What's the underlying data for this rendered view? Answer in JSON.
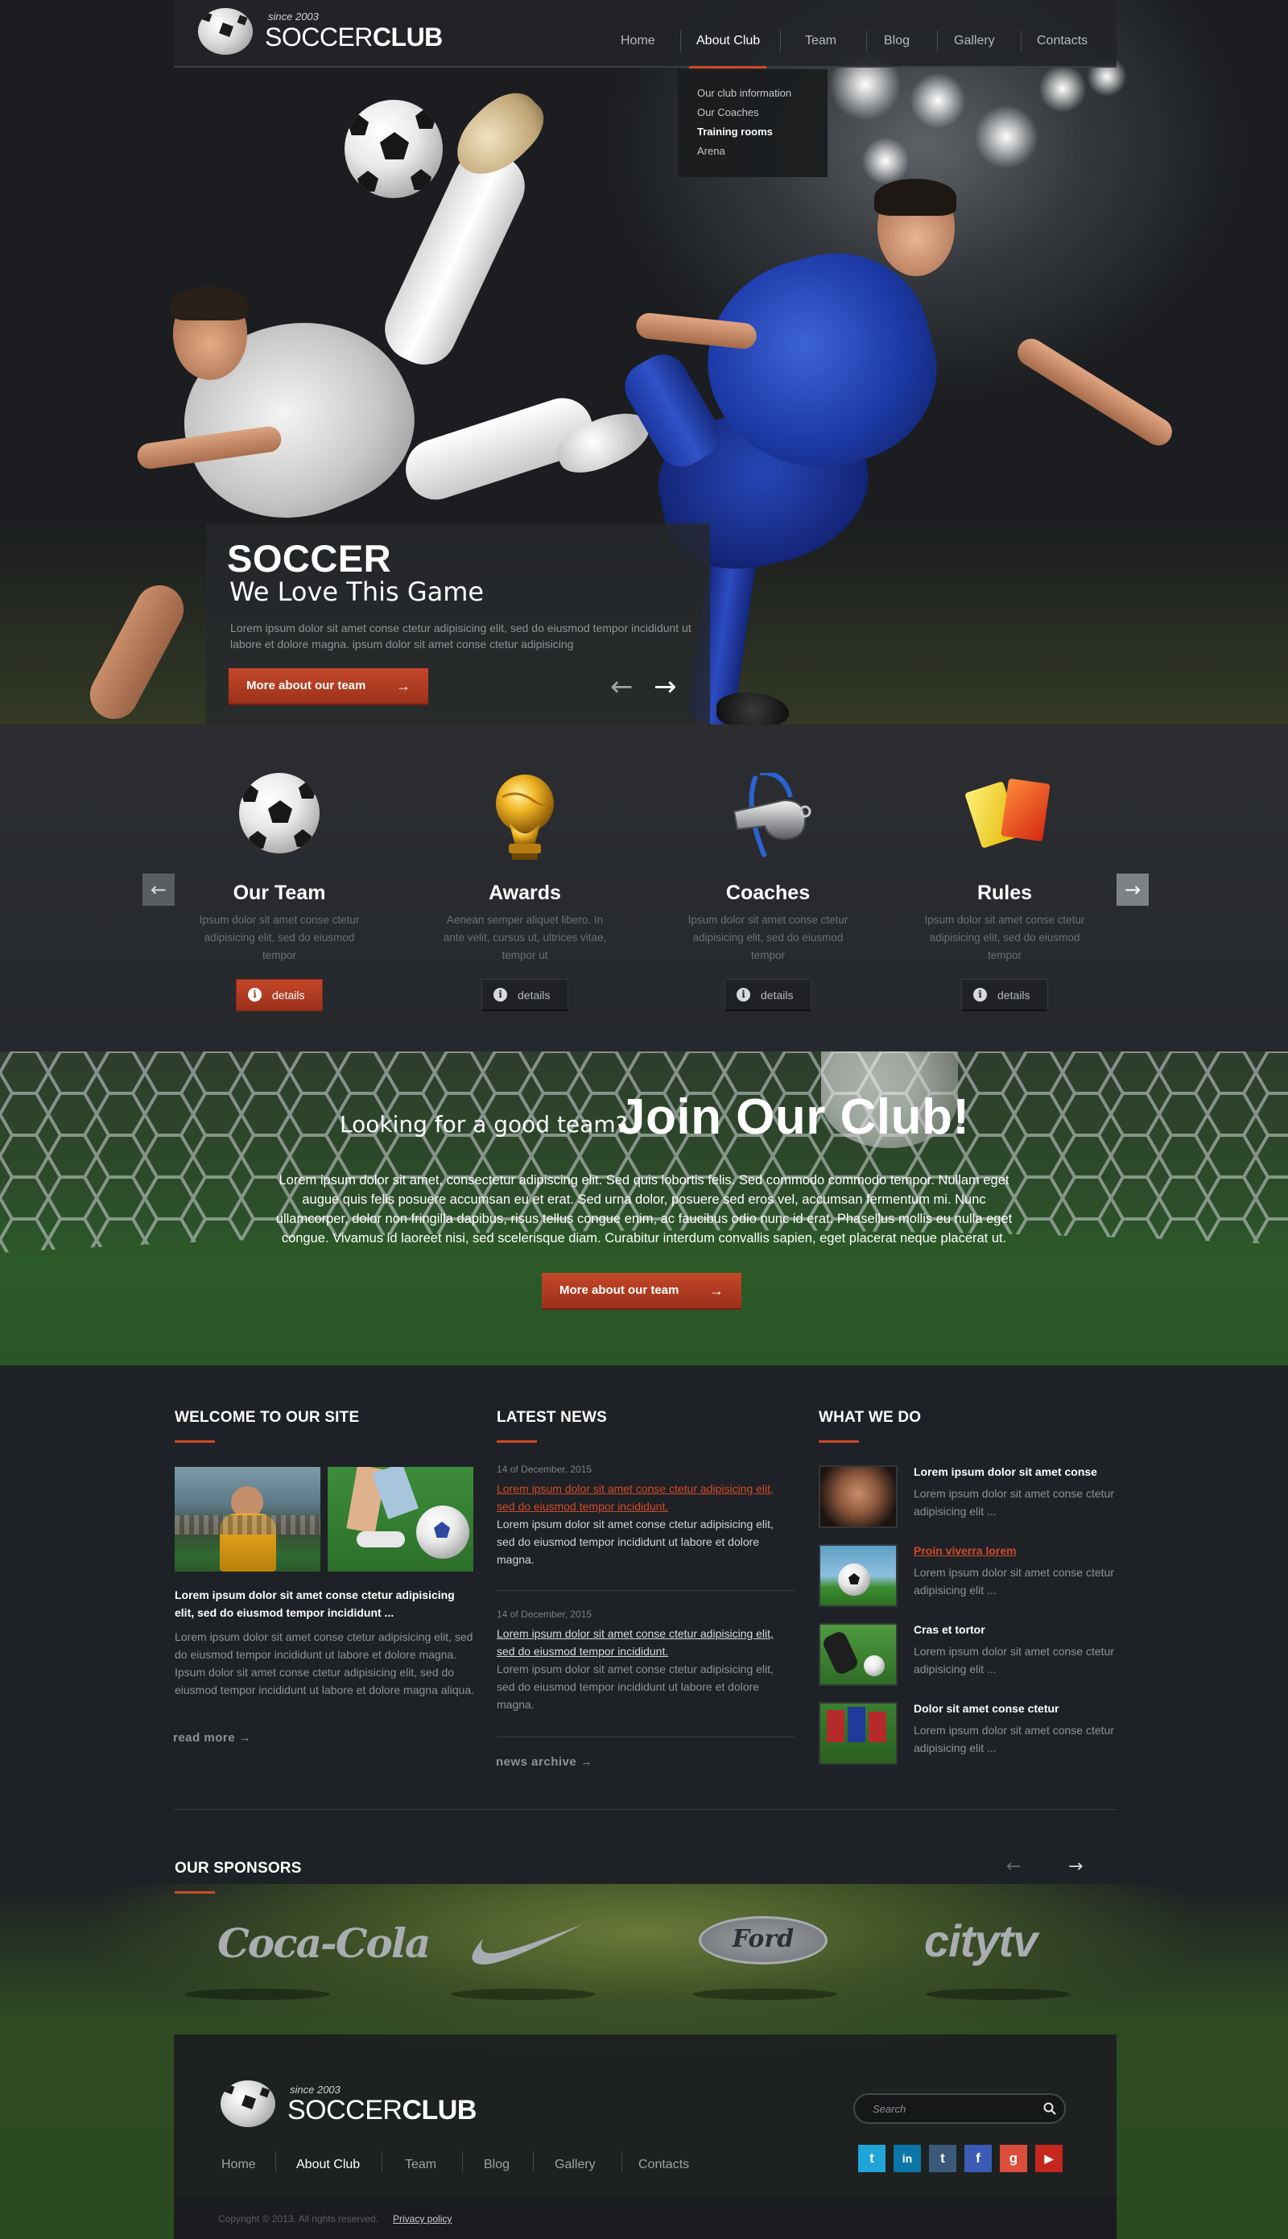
{
  "logo": {
    "tagline": "since 2003",
    "name_light": "SOCCER",
    "name_bold": "CLUB"
  },
  "nav": {
    "items": [
      "Home",
      "About Club",
      "Team",
      "Blog",
      "Gallery",
      "Contacts"
    ],
    "active": "About Club",
    "dropdown": [
      "Our club information",
      "Our Coaches",
      "Training rooms",
      "Arena"
    ],
    "dropdown_active": "Training rooms"
  },
  "hero": {
    "title": "SOCCER",
    "subtitle": "We Love This Game",
    "text": "Lorem ipsum dolor sit amet conse ctetur adipisicing elit, sed do eiusmod tempor incididunt ut labore et dolore magna. ipsum dolor sit amet conse ctetur adipisicing",
    "button": "More about our team",
    "prev_icon": "arrow-left-icon",
    "next_icon": "arrow-right-icon"
  },
  "features": [
    {
      "title": "Our Team",
      "text": "Ipsum dolor sit amet conse ctetur adipisicing elit, sed do eiusmod tempor",
      "button": "details",
      "icon": "soccer-ball-icon"
    },
    {
      "title": "Awards",
      "text": "Aenean semper aliquet libero. In ante velit, cursus ut, ultrices vitae, tempor ut",
      "button": "details",
      "icon": "trophy-icon"
    },
    {
      "title": "Coaches",
      "text": "Ipsum dolor sit amet conse ctetur adipisicing elit, sed do eiusmod tempor",
      "button": "details",
      "icon": "whistle-icon"
    },
    {
      "title": "Rules",
      "text": "Ipsum dolor sit amet conse ctetur adipisicing elit, sed do eiusmod tempor",
      "button": "details",
      "icon": "cards-icon"
    }
  ],
  "join": {
    "tagline": "Looking for a good team?",
    "title": "Join Our Club!",
    "text": "Lorem ipsum dolor sit amet, consectetur adipiscing elit. Sed quis lobortis felis. Sed commodo commodo tempor. Nullam eget augue quis felis posuere accumsan eu et erat. Sed urna dolor, posuere sed eros vel, accumsan fermentum mi. Nunc ullamcorper, dolor non fringilla dapibus, risus tellus congue enim, ac faucibus odio nunc id erat. Phasellus mollis eu nulla eget congue. Vivamus id laoreet nisi, sed scelerisque diam. Curabitur interdum convallis sapien, eget placerat neque placerat ut.",
    "button": "More about our team"
  },
  "welcome": {
    "title": "WELCOME TO OUR SITE",
    "lead": "Lorem ipsum dolor sit amet conse ctetur adipisicing elit, sed do eiusmod tempor incididunt ...",
    "text": "Lorem ipsum dolor sit amet conse ctetur adipisicing elit, sed do eiusmod tempor incididunt ut labore et dolore magna. Ipsum dolor sit amet conse ctetur adipisicing elit, sed do eiusmod tempor incididunt ut labore et dolore magna aliqua.",
    "more": "read more →"
  },
  "news": {
    "title": "LATEST NEWS",
    "items": [
      {
        "date": "14 of December, 2015",
        "link": "Lorem ipsum dolor sit amet conse ctetur adipisicing elit, sed do eiusmod tempor incididunt.",
        "text": "Lorem ipsum dolor sit amet conse ctetur adipisicing elit, sed do eiusmod tempor incididunt ut labore et dolore magna."
      },
      {
        "date": "14 of December, 2015",
        "link": "Lorem ipsum dolor sit amet conse ctetur adipisicing elit, sed do eiusmod tempor incididunt.",
        "text": "Lorem ipsum dolor sit amet conse ctetur adipisicing elit, sed do eiusmod tempor incididunt ut labore et dolore magna."
      }
    ],
    "archive": "news archive →"
  },
  "what_we_do": {
    "title": "WHAT WE DO",
    "items": [
      {
        "title": "Lorem ipsum dolor sit amet conse",
        "text": "Lorem ipsum dolor sit amet conse ctetur adipisicing elit ..."
      },
      {
        "title": "Proin viverra lorem",
        "text": "Lorem ipsum dolor sit amet conse ctetur adipisicing elit ..."
      },
      {
        "title": "Cras et tortor",
        "text": "Lorem ipsum dolor sit amet conse ctetur adipisicing elit ..."
      },
      {
        "title": "Dolor sit amet conse ctetur",
        "text": "Lorem ipsum dolor sit amet conse ctetur adipisicing elit ..."
      }
    ]
  },
  "sponsors": {
    "title": "OUR SPONSORS",
    "logos": [
      "Coca-Cola",
      "Nike",
      "Ford",
      "citytv"
    ],
    "logo_texts": {
      "coca": "Coca-Cola",
      "ford": "Ford",
      "citytv": "citytv"
    }
  },
  "footer": {
    "nav": [
      "Home",
      "About Club",
      "Team",
      "Blog",
      "Gallery",
      "Contacts"
    ],
    "active": "About Club",
    "search_placeholder": "Search",
    "social": [
      "twitter-icon",
      "linkedin-icon",
      "tumblr-icon",
      "facebook-icon",
      "google-plus-icon",
      "youtube-icon"
    ],
    "social_glyphs": [
      "t",
      "in",
      "t",
      "f",
      "g",
      "▶"
    ],
    "copyright": "Copyright © 2013. All rights reserved.",
    "privacy": "Privacy policy"
  },
  "colors": {
    "accent": "#cc4b26",
    "background": "#1e2125",
    "panel": "#2b2d31"
  }
}
